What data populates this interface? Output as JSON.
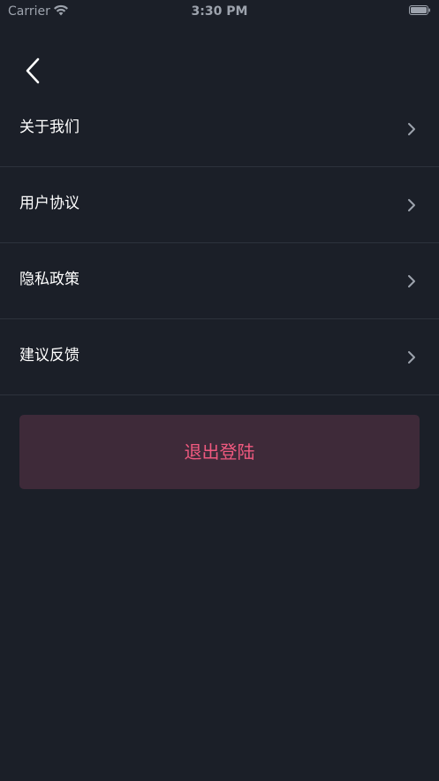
{
  "status_bar": {
    "carrier": "Carrier",
    "time": "3:30 PM",
    "icons": [
      "wifi-icon",
      "battery-icon"
    ]
  },
  "nav": {
    "back_icon": "chevron-left-icon"
  },
  "menu": {
    "items": [
      {
        "label": "关于我们",
        "icon": "chevron-right-icon"
      },
      {
        "label": "用户协议",
        "icon": "chevron-right-icon"
      },
      {
        "label": "隐私政策",
        "icon": "chevron-right-icon"
      },
      {
        "label": "建议反馈",
        "icon": "chevron-right-icon"
      }
    ]
  },
  "logout": {
    "label": "退出登陆"
  },
  "colors": {
    "background": "#1b1f28",
    "divider": "#2d323c",
    "logout_bg": "#3e2a39",
    "logout_text": "#f0597f",
    "chevron": "#9da3ad"
  }
}
